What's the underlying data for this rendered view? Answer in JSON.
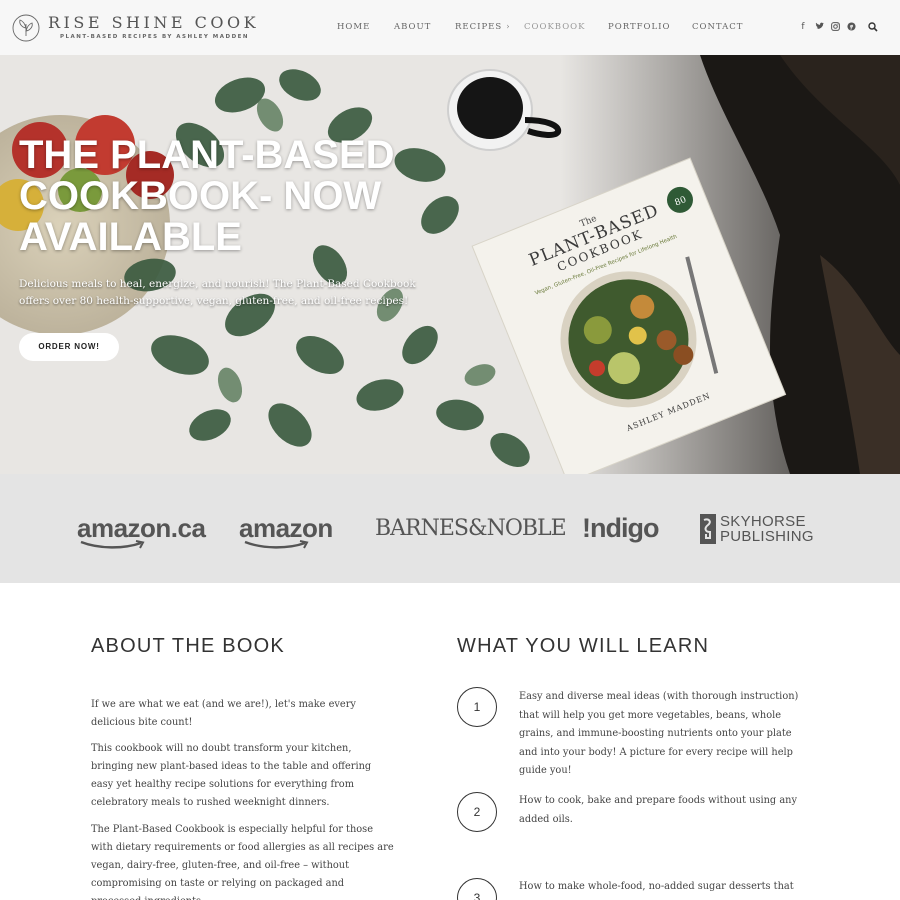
{
  "header": {
    "logo_title": "RISE SHINE COOK",
    "logo_tagline": "PLANT-BASED RECIPES BY ASHLEY MADDEN",
    "nav": [
      {
        "label": "HOME"
      },
      {
        "label": "ABOUT"
      },
      {
        "label": "RECIPES",
        "has_dropdown": true,
        "dropdown_glyph": "›"
      },
      {
        "label": "COOKBOOK",
        "active": true
      },
      {
        "label": "PORTFOLIO"
      },
      {
        "label": "CONTACT"
      }
    ],
    "social_icons": [
      {
        "name": "facebook-icon",
        "glyph": "f"
      },
      {
        "name": "twitter-icon",
        "glyph": "🐦"
      },
      {
        "name": "instagram-icon",
        "glyph": "◎"
      },
      {
        "name": "pinterest-icon",
        "glyph": "℗"
      },
      {
        "name": "search-icon",
        "glyph": "⌕"
      }
    ]
  },
  "hero": {
    "title": "THE PLANT-BASED COOKBOOK- NOW AVAILABLE",
    "subtitle": "Delicious meals to heal, energize, and nourish! The Plant-Based Cookbook offers over 80 health-supportive, vegan, gluten-free, and oil-free recipes!",
    "cta_label": "ORDER NOW!",
    "book": {
      "title_top": "The",
      "title_main": "PLANT-BASED",
      "title_sub": "COOKBOOK",
      "tagline": "Vegan, Gluten-Free, Oil-Free Recipes for Lifelong Health",
      "badge": "80",
      "author": "ASHLEY MADDEN"
    }
  },
  "retailers": [
    {
      "name": "amazon.ca"
    },
    {
      "name": "amazon"
    },
    {
      "name": "BARNES&NOBLE"
    },
    {
      "name": "!ndigo"
    },
    {
      "name_line1": "SKYHORSE",
      "name_line2": "PUBLISHING"
    }
  ],
  "about": {
    "heading": "ABOUT THE BOOK",
    "paragraphs": [
      "If we are what we eat (and we are!), let's make every delicious bite count!",
      "This cookbook will no doubt transform your kitchen, bringing new plant-based ideas to the table and offering easy yet healthy recipe solutions for everything from celebratory meals to rushed weeknight dinners.",
      "The Plant-Based Cookbook is especially helpful for those with dietary requirements or food allergies as all recipes are vegan, dairy-free, gluten-free, and oil-free – without compromising on taste or relying on packaged and processed ingredients."
    ]
  },
  "learn": {
    "heading": "WHAT YOU WILL LEARN",
    "items": [
      {
        "num": "1",
        "text": "Easy and diverse meal ideas (with thorough instruction) that will help you get more vegetables, beans, whole grains, and immune-boosting nutrients onto your plate and into your body! A picture for every recipe will help guide you!"
      },
      {
        "num": "2",
        "text": "How to cook, bake and prepare foods without using any added oils."
      },
      {
        "num": "3",
        "text": "How to make whole-food, no-added sugar desserts that can be"
      }
    ]
  },
  "colors": {
    "header_bg": "#f7f7f7",
    "retailer_band_bg": "#e4e4e4",
    "text_dark": "#333333",
    "logo_gray": "#555555",
    "button_bg": "#ffffff"
  }
}
